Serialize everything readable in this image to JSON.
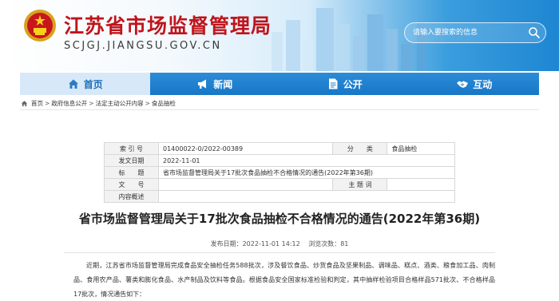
{
  "header": {
    "site_title": "江苏省市场监督管理局",
    "site_domain": "SCJGJ.JIANGSU.GOV.CN",
    "search_placeholder": "请输入要搜索的信息",
    "colors": {
      "title_red": "#c0141b",
      "header_blue": "#1e86d2"
    },
    "emblem_icon": "national-emblem-icon",
    "search_icon": "search-icon"
  },
  "nav": {
    "items": [
      {
        "label": "首页",
        "icon": "home-icon",
        "active": true
      },
      {
        "label": "新闻",
        "icon": "megaphone-icon",
        "active": false
      },
      {
        "label": "公开",
        "icon": "document-icon",
        "active": false
      },
      {
        "label": "互动",
        "icon": "handshake-icon",
        "active": false
      }
    ],
    "colors": {
      "bar": "#1677c7",
      "active_bg": "#d7e9f8"
    }
  },
  "breadcrumb": {
    "items": [
      "首页",
      "政府信息公开",
      "法定主动公开内容",
      "食品抽检"
    ],
    "separator": ">"
  },
  "info_table": {
    "index_label": "索 引 号",
    "index_value": "01400022-0/2022-00389",
    "category_label": "分　　类",
    "category_value": "食品抽检",
    "issuer_label": "发文日期",
    "issuer_value": "2022-11-01",
    "title_label": "标　　题",
    "title_value": "省市场监督管理局关于17批次食品抽检不合格情况的通告(2022年第36期)",
    "doc_no_label": "文　　号",
    "doc_no_value": "",
    "subject_label": "主 题 词",
    "subject_value": "",
    "summary_label": "内容概述",
    "summary_value": ""
  },
  "article": {
    "title": "省市场监督管理局关于17批次食品抽检不合格情况的通告(2022年第36期)",
    "publish_label": "发布日期：",
    "publish_time": "2022-11-01 14:12",
    "views_label": "浏览次数：",
    "views": "81",
    "paragraph": "近期，江苏省市场监督管理局完成食品安全抽检任务588批次，涉及餐饮食品、炒货食品及坚果制品、调味品、糕点、酒类、粮食加工品、肉制品、食用农产品、薯类和膨化食品、水产制品及饮料等食品。根据食品安全国家标准检验和判定，其中抽样检验项目合格样品571批次、不合格样品17批次，情况通告如下："
  }
}
